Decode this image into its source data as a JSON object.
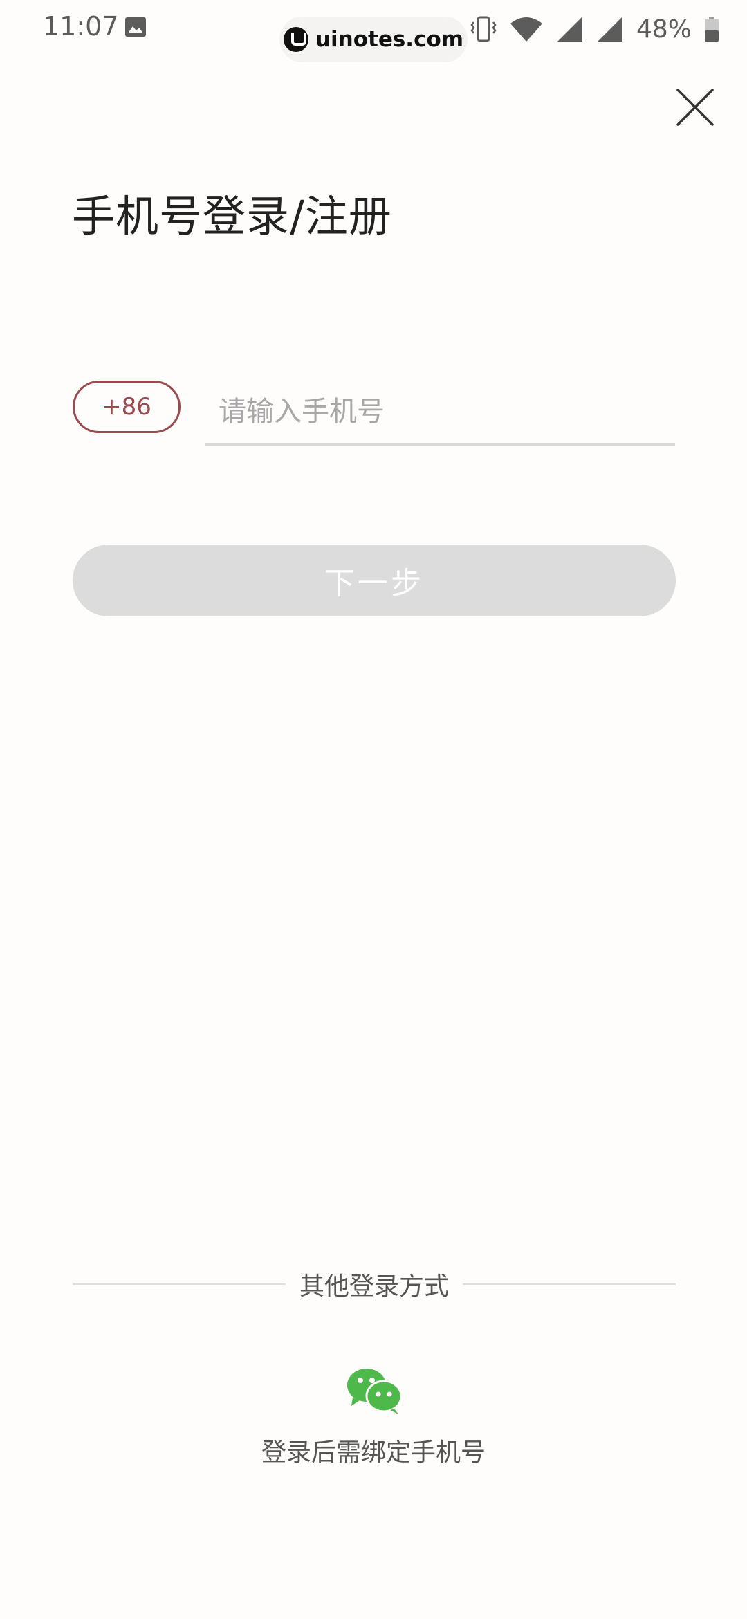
{
  "status_bar": {
    "time": "11:07",
    "battery": "48%",
    "watermark": "uinotes.com",
    "icons": [
      "photo-icon",
      "vibrate-icon",
      "wifi-icon",
      "signal-icon",
      "signal-icon",
      "battery-icon"
    ]
  },
  "login": {
    "title": "手机号登录/注册",
    "country_code": "+86",
    "phone_placeholder": "请输入手机号",
    "phone_value": "",
    "next_label": "下一步",
    "next_bg": "#dcdcdc",
    "accent": "#9b4a4f"
  },
  "other_login": {
    "divider_text": "其他登录方式",
    "wechat_icon": "wechat-icon",
    "wechat_color": "#4fb84a",
    "note": "登录后需绑定手机号"
  }
}
